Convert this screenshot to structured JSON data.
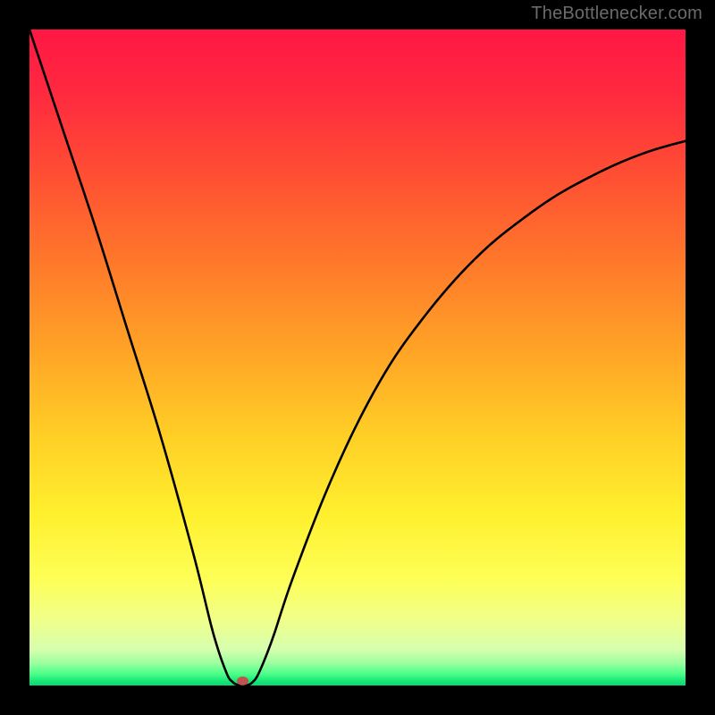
{
  "watermark": "TheBottlenecker.com",
  "chart_data": {
    "type": "line",
    "title": "",
    "xlabel": "",
    "ylabel": "",
    "xlim": [
      0,
      100
    ],
    "ylim": [
      0,
      100
    ],
    "series": [
      {
        "name": "bottleneck-curve",
        "x": [
          0,
          5,
          10,
          15,
          20,
          25,
          28,
          30,
          31,
          32,
          33,
          34,
          35,
          37,
          40,
          45,
          50,
          55,
          60,
          65,
          70,
          75,
          80,
          85,
          90,
          95,
          100
        ],
        "values": [
          100,
          85,
          70,
          54,
          38,
          20,
          8,
          2,
          0.5,
          0,
          0,
          0.5,
          2,
          7,
          16,
          29,
          40,
          49,
          56,
          62,
          67,
          71,
          74.5,
          77.3,
          79.7,
          81.6,
          83
        ]
      }
    ],
    "marker": {
      "x": 32.5,
      "y": 0.7,
      "color": "#c0534e"
    },
    "background_gradient_stops": [
      {
        "pos": 0.0,
        "color": "#ff1744"
      },
      {
        "pos": 0.1,
        "color": "#ff2a3f"
      },
      {
        "pos": 0.22,
        "color": "#ff4e33"
      },
      {
        "pos": 0.36,
        "color": "#ff7a2a"
      },
      {
        "pos": 0.5,
        "color": "#ffa726"
      },
      {
        "pos": 0.62,
        "color": "#ffcf26"
      },
      {
        "pos": 0.74,
        "color": "#fff02e"
      },
      {
        "pos": 0.84,
        "color": "#fdff58"
      },
      {
        "pos": 0.9,
        "color": "#f0ff8a"
      },
      {
        "pos": 0.945,
        "color": "#d6ffae"
      },
      {
        "pos": 0.965,
        "color": "#9effa0"
      },
      {
        "pos": 0.982,
        "color": "#4eff88"
      },
      {
        "pos": 0.993,
        "color": "#17e879"
      },
      {
        "pos": 1.0,
        "color": "#0bd672"
      }
    ]
  }
}
